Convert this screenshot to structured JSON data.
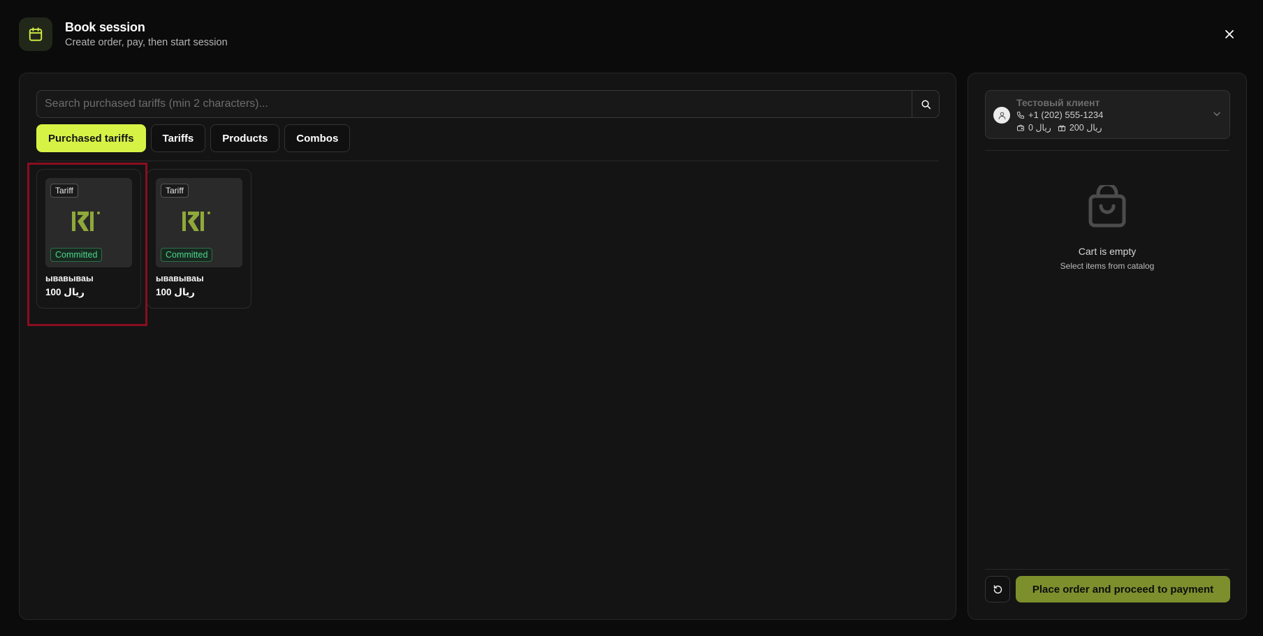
{
  "header": {
    "title": "Book session",
    "subtitle": "Create order, pay, then start session",
    "icon": "calendar-icon",
    "accent": "#d6f345"
  },
  "search": {
    "placeholder": "Search purchased tariffs (min 2 characters)...",
    "value": ""
  },
  "tabs": [
    {
      "label": "Purchased tariffs",
      "active": true
    },
    {
      "label": "Tariffs",
      "active": false
    },
    {
      "label": "Products",
      "active": false
    },
    {
      "label": "Combos",
      "active": false
    }
  ],
  "cards": [
    {
      "type_badge": "Tariff",
      "status_badge": "Committed",
      "name": "ывавываы",
      "price": "100 ریال"
    },
    {
      "type_badge": "Tariff",
      "status_badge": "Committed",
      "name": "ывавываы",
      "price": "100 ریال"
    }
  ],
  "client": {
    "name": "Тестовый клиент",
    "phone": "+1 (202) 555-1234",
    "balance": "0 ریال",
    "bonus": "200 ریال"
  },
  "cart": {
    "empty_title": "Cart is empty",
    "empty_subtitle": "Select items from catalog"
  },
  "footer": {
    "place_order_label": "Place order and proceed to payment"
  },
  "colors": {
    "background": "#0b0b0b",
    "panel": "#141414",
    "active_tab": "#d6f345",
    "primary_button": "#7d8f2c",
    "committed": "#4fd38c",
    "highlight": "#8a0d1f"
  }
}
